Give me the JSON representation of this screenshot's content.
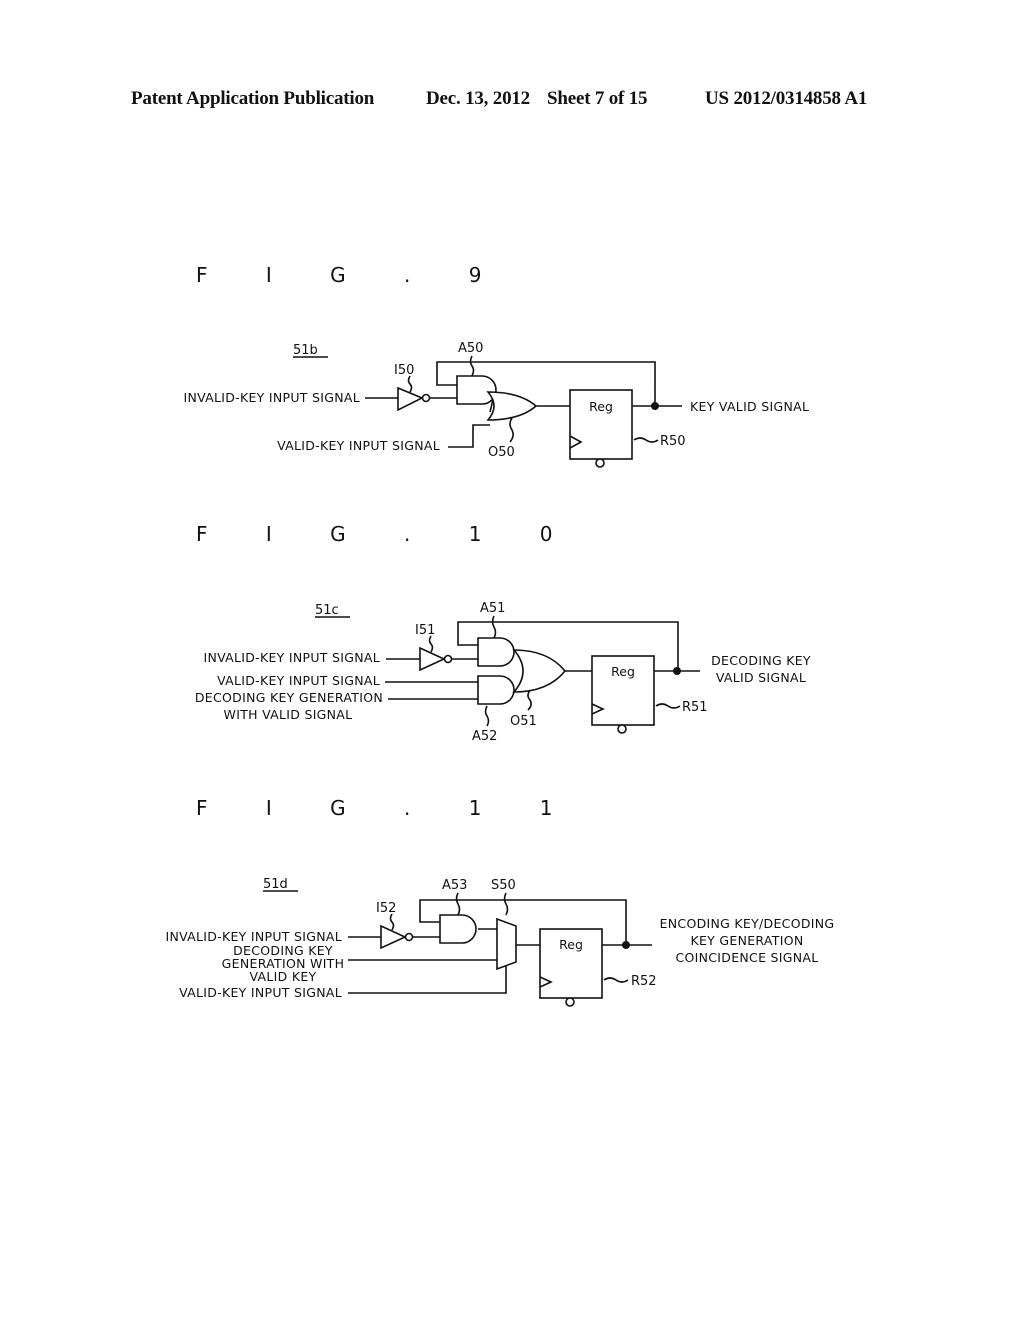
{
  "header": {
    "publication": "Patent Application Publication",
    "date": "Dec. 13, 2012",
    "sheet": "Sheet 7 of 15",
    "number": "US 2012/0314858 A1"
  },
  "figures": [
    {
      "title": "F I G . 9",
      "block": "51b",
      "inverter": "I50",
      "and_gates": [
        "A50"
      ],
      "or_gate": "O50",
      "register": {
        "label": "Reg",
        "ref": "R50"
      },
      "inputs": [
        "INVALID-KEY INPUT SIGNAL",
        "VALID-KEY INPUT SIGNAL"
      ],
      "output": [
        "KEY VALID SIGNAL"
      ]
    },
    {
      "title": "F I G . 1 0",
      "block": "51c",
      "inverter": "I51",
      "and_gates": [
        "A51",
        "A52"
      ],
      "or_gate": "O51",
      "register": {
        "label": "Reg",
        "ref": "R51"
      },
      "inputs": [
        "INVALID-KEY INPUT SIGNAL",
        "VALID-KEY INPUT SIGNAL",
        "DECODING KEY GENERATION",
        "WITH VALID SIGNAL"
      ],
      "output": [
        "DECODING KEY",
        "VALID SIGNAL"
      ]
    },
    {
      "title": "F I G . 1 1",
      "block": "51d",
      "inverter": "I52",
      "and_gates": [
        "A53"
      ],
      "selector": "S50",
      "register": {
        "label": "Reg",
        "ref": "R52"
      },
      "inputs": [
        "INVALID-KEY INPUT SIGNAL",
        "DECODING KEY",
        "GENERATION WITH",
        "VALID KEY",
        "VALID-KEY INPUT SIGNAL"
      ],
      "output": [
        "ENCODING KEY/DECODING",
        "KEY GENERATION",
        "COINCIDENCE SIGNAL"
      ]
    }
  ]
}
